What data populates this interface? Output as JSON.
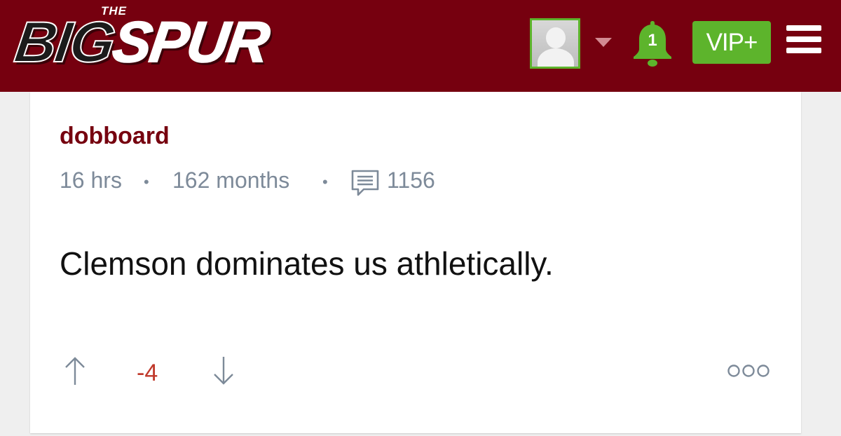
{
  "header": {
    "logo": {
      "prefix": "THE",
      "word_big": "BIG",
      "word_spur": "SPUR"
    },
    "notifications_count": "1",
    "vip_label": "VIP+",
    "colors": {
      "brand": "#76000f",
      "accent_green": "#5db42c"
    },
    "icons": [
      "avatar-icon",
      "caret-down-icon",
      "bell-icon",
      "hamburger-menu-icon"
    ]
  },
  "post": {
    "username": "dobboard",
    "meta": {
      "posted": "16 hrs",
      "member_for": "162 months",
      "post_count": "1156"
    },
    "body": "Clemson dominates us athletically.",
    "score": "-4",
    "icons": [
      "comment-icon",
      "arrow-up-icon",
      "arrow-down-icon",
      "more-options-icon"
    ]
  }
}
